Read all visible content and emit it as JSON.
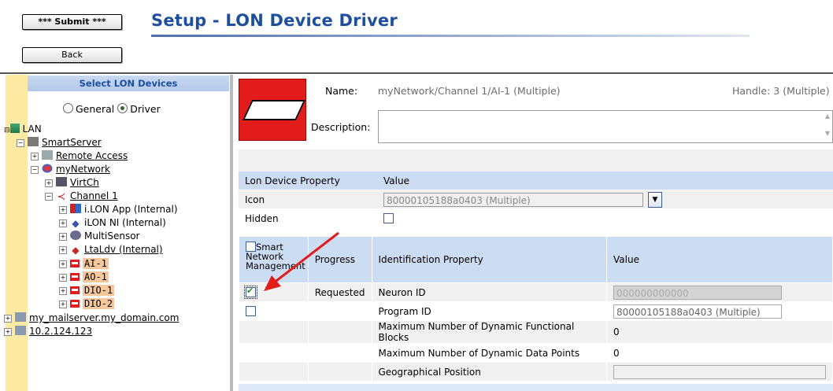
{
  "toolbar": {
    "submit_label": "*** Submit ***",
    "back_label": "Back"
  },
  "page": {
    "title": "Setup - LON Device Driver"
  },
  "tree": {
    "header": "Select LON Devices",
    "mode_general": "General",
    "mode_driver": "Driver",
    "selected_mode": "Driver",
    "nodes": {
      "lan": "LAN",
      "smartserver": "SmartServer",
      "remote_access": "Remote Access",
      "mynetwork": "myNetwork",
      "virtch": "VirtCh",
      "channel1": "Channel 1",
      "ilon_app": "i.LON App (Internal)",
      "ilon_ni": "iLON NI (Internal)",
      "multisensor": "MultiSensor",
      "ltaldv": "LtaLdv (Internal)",
      "ai1": "AI-1",
      "ao1": "AO-1",
      "dio1": "DIO-1",
      "dio2": "DIO-2",
      "mailserver": "my_mailserver.my_domain.com",
      "ip": "10.2.124.123"
    }
  },
  "device": {
    "name_label": "Name:",
    "name_value": "myNetwork/Channel 1/AI-1 (Multiple)",
    "handle_label": "Handle:",
    "handle_value": "3 (Multiple)",
    "description_label": "Description:",
    "description_value": ""
  },
  "properties": {
    "col_property": "Lon Device Property",
    "col_value": "Value",
    "icon_label": "Icon",
    "icon_value": "80000105188a0403 (Multiple)",
    "hidden_label": "Hidden",
    "hidden_checked": false
  },
  "identification": {
    "col_snm": "Smart Network Management",
    "col_progress": "Progress",
    "col_property": "Identification Property",
    "col_value": "Value",
    "rows": [
      {
        "checked": true,
        "progress": "Requested",
        "property": "Neuron ID",
        "value": "000000000000"
      },
      {
        "checked": false,
        "progress": "",
        "property": "Program ID",
        "value": "80000105188a0403 (Multiple)"
      },
      {
        "progress": "",
        "property": "Maximum Number of Dynamic Functional Blocks",
        "value": "0"
      },
      {
        "progress": "",
        "property": "Maximum Number of Dynamic Data Points",
        "value": "0"
      },
      {
        "progress": "",
        "property": "Geographical Position",
        "value": ""
      }
    ]
  },
  "colors": {
    "title": "#1d4f9e",
    "header_blue": "#ccdcf3",
    "tree_gutter": "#ffeaa3",
    "device_red": "#e21b1b",
    "highlight": "#f6c79a",
    "arrow": "#e21b1b"
  }
}
